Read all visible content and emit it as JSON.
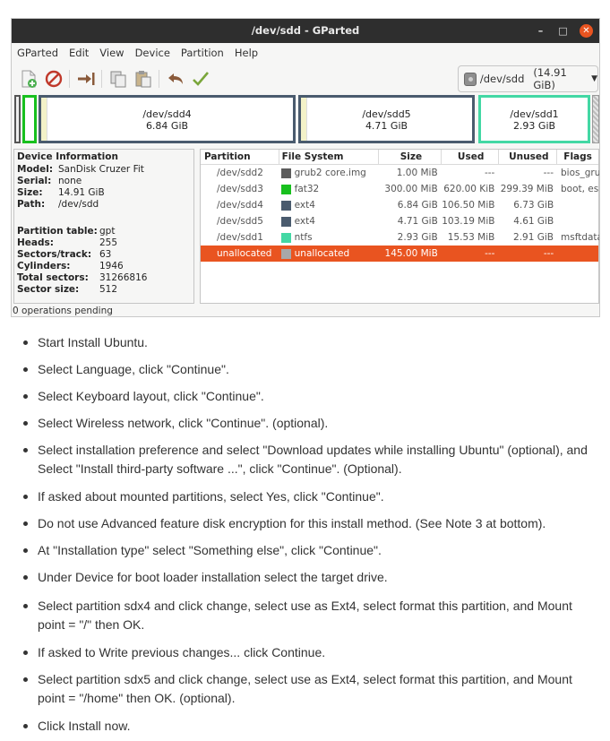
{
  "window": {
    "title": "/dev/sdd - GParted",
    "controls": {
      "minimize": "–",
      "maximize": "□",
      "close": "✕"
    }
  },
  "menu": [
    "GParted",
    "Edit",
    "View",
    "Device",
    "Partition",
    "Help"
  ],
  "toolbar": {
    "icons": [
      "new-partition-icon",
      "delete-icon",
      "resize-move-icon",
      "copy-icon",
      "paste-icon",
      "undo-icon",
      "apply-icon"
    ],
    "device_select": {
      "device": "/dev/sdd",
      "size": "(14.91 GiB)"
    }
  },
  "disk_map": {
    "partitions": [
      {
        "name": "/dev/sdd4",
        "size": "6.84 GiB"
      },
      {
        "name": "/dev/sdd5",
        "size": "4.71 GiB"
      },
      {
        "name": "/dev/sdd1",
        "size": "2.93 GiB"
      }
    ]
  },
  "device_info": {
    "header": "Device Information",
    "basic": [
      {
        "key": "Model:",
        "value": "SanDisk Cruzer Fit"
      },
      {
        "key": "Serial:",
        "value": "none"
      },
      {
        "key": "Size:",
        "value": "14.91 GiB"
      },
      {
        "key": "Path:",
        "value": "/dev/sdd"
      }
    ],
    "geometry": [
      {
        "key": "Partition table:",
        "value": "gpt"
      },
      {
        "key": "Heads:",
        "value": "255"
      },
      {
        "key": "Sectors/track:",
        "value": "63"
      },
      {
        "key": "Cylinders:",
        "value": "1946"
      },
      {
        "key": "Total sectors:",
        "value": "31266816"
      },
      {
        "key": "Sector size:",
        "value": "512"
      }
    ]
  },
  "partition_table": {
    "columns": [
      "Partition",
      "File System",
      "Size",
      "Used",
      "Unused",
      "Flags"
    ],
    "rows": [
      {
        "partition": "/dev/sdd2",
        "fs": "grub2 core.img",
        "fs_color": "#5c5c5c",
        "size": "1.00 MiB",
        "used": "---",
        "unused": "---",
        "flags": "bios_grub"
      },
      {
        "partition": "/dev/sdd3",
        "fs": "fat32",
        "fs_color": "#18c01e",
        "size": "300.00 MiB",
        "used": "620.00 KiB",
        "unused": "299.39 MiB",
        "flags": "boot, esp"
      },
      {
        "partition": "/dev/sdd4",
        "fs": "ext4",
        "fs_color": "#4a5b6e",
        "size": "6.84 GiB",
        "used": "106.50 MiB",
        "unused": "6.73 GiB",
        "flags": ""
      },
      {
        "partition": "/dev/sdd5",
        "fs": "ext4",
        "fs_color": "#4a5b6e",
        "size": "4.71 GiB",
        "used": "103.19 MiB",
        "unused": "4.61 GiB",
        "flags": ""
      },
      {
        "partition": "/dev/sdd1",
        "fs": "ntfs",
        "fs_color": "#43d8a4",
        "size": "2.93 GiB",
        "used": "15.53 MiB",
        "unused": "2.91 GiB",
        "flags": "msftdata"
      },
      {
        "partition": "unallocated",
        "fs": "unallocated",
        "fs_color": "#a8a8a8",
        "size": "145.00 MiB",
        "used": "---",
        "unused": "---",
        "flags": "",
        "selected": true
      }
    ]
  },
  "status": "0 operations pending",
  "steps": [
    "Start Install Ubuntu.",
    "Select Language, click \"Continue\".",
    "Select Keyboard layout, click \"Continue\".",
    "Select Wireless network, click \"Continue\". (optional).",
    "Select installation preference and select \"Download updates while installing Ubuntu\" (optional), and Select \"Install third-party software ...\", click \"Continue\". (Optional).",
    "If asked about mounted partitions, select Yes, click \"Continue\".",
    "Do not use Advanced feature disk encryption for this install method. (See Note 3 at bottom).",
    "At \"Installation type\" select \"Something else\", click \"Continue\".",
    "Under Device for boot loader installation select the target drive.",
    "Select partition sdx4 and click change, select use as Ext4, select format this partition, and Mount point = \"/\" then OK.",
    "If asked to Write previous changes... click Continue.",
    "Select partition sdx5 and click change, select use as Ext4, select format this partition, and Mount point = \"/home\" then OK. (optional).",
    "Click Install now."
  ],
  "colors": {
    "accent": "#e95420",
    "ext4": "#4a5b6e",
    "fat32": "#18c01e",
    "ntfs": "#43d8a4"
  }
}
